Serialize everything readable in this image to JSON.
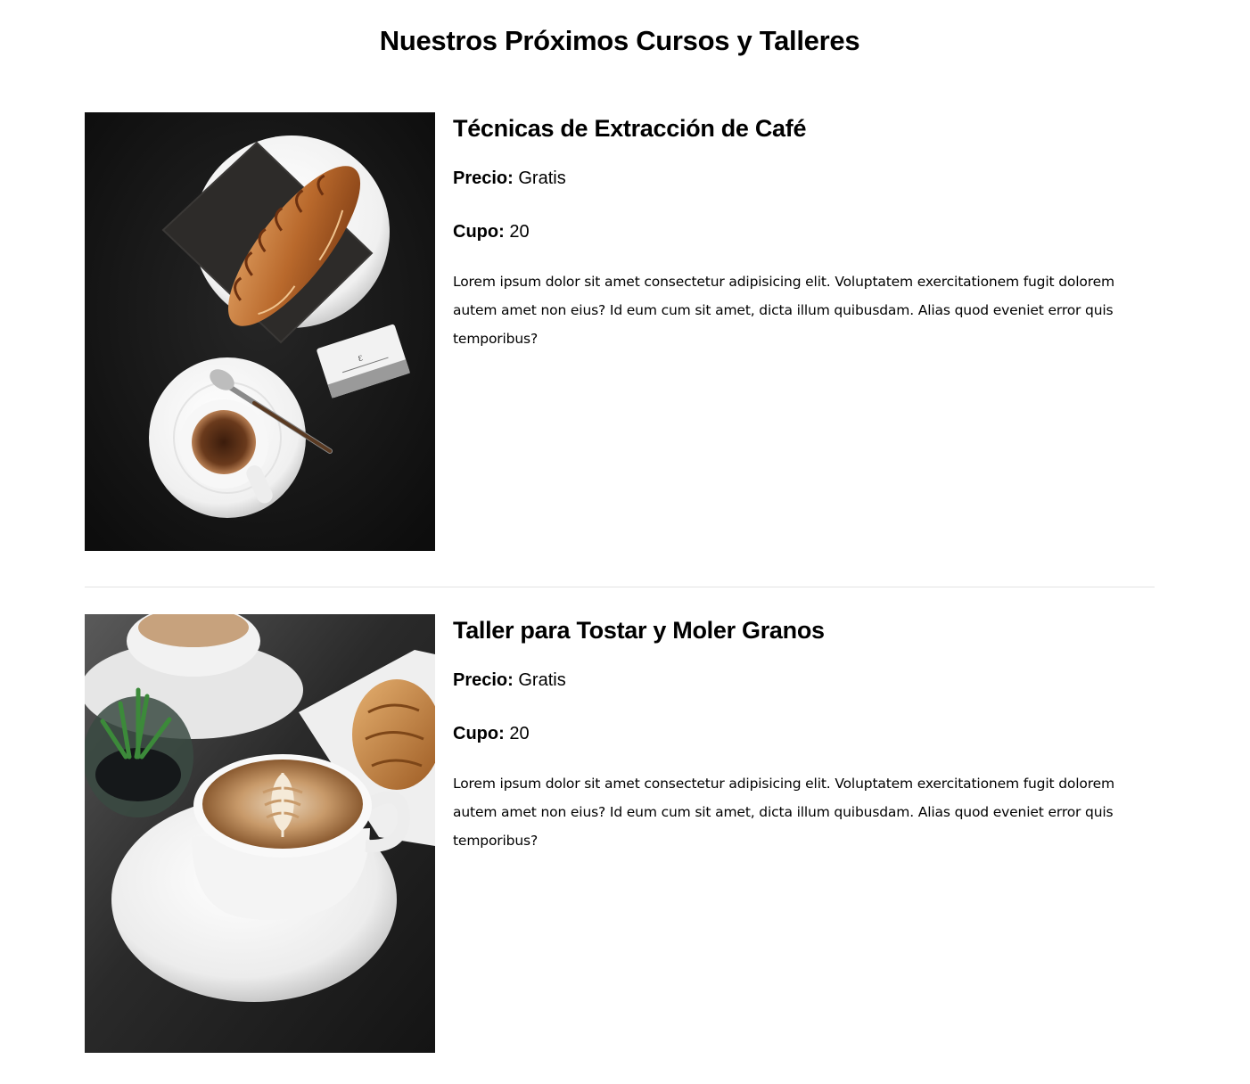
{
  "page": {
    "title": "Nuestros Próximos Cursos y Talleres"
  },
  "courses": [
    {
      "title": "Técnicas de Extracción de Café",
      "price_label": "Precio:",
      "price_value": "Gratis",
      "capacity_label": "Cupo:",
      "capacity_value": "20",
      "description": "Lorem ipsum dolor sit amet consectetur adipisicing elit. Voluptatem exercitationem fugit dolorem autem amet non eius? Id eum cum sit amet, dicta illum quibusdam. Alias quod eveniet error quis temporibus?",
      "image": "espresso-croissant-photo"
    },
    {
      "title": "Taller para Tostar y Moler Granos",
      "price_label": "Precio:",
      "price_value": "Gratis",
      "capacity_label": "Cupo:",
      "capacity_value": "20",
      "description": "Lorem ipsum dolor sit amet consectetur adipisicing elit. Voluptatem exercitationem fugit dolorem autem amet non eius? Id eum cum sit amet, dicta illum quibusdam. Alias quod eveniet error quis temporibus?",
      "image": "latte-art-photo"
    }
  ]
}
